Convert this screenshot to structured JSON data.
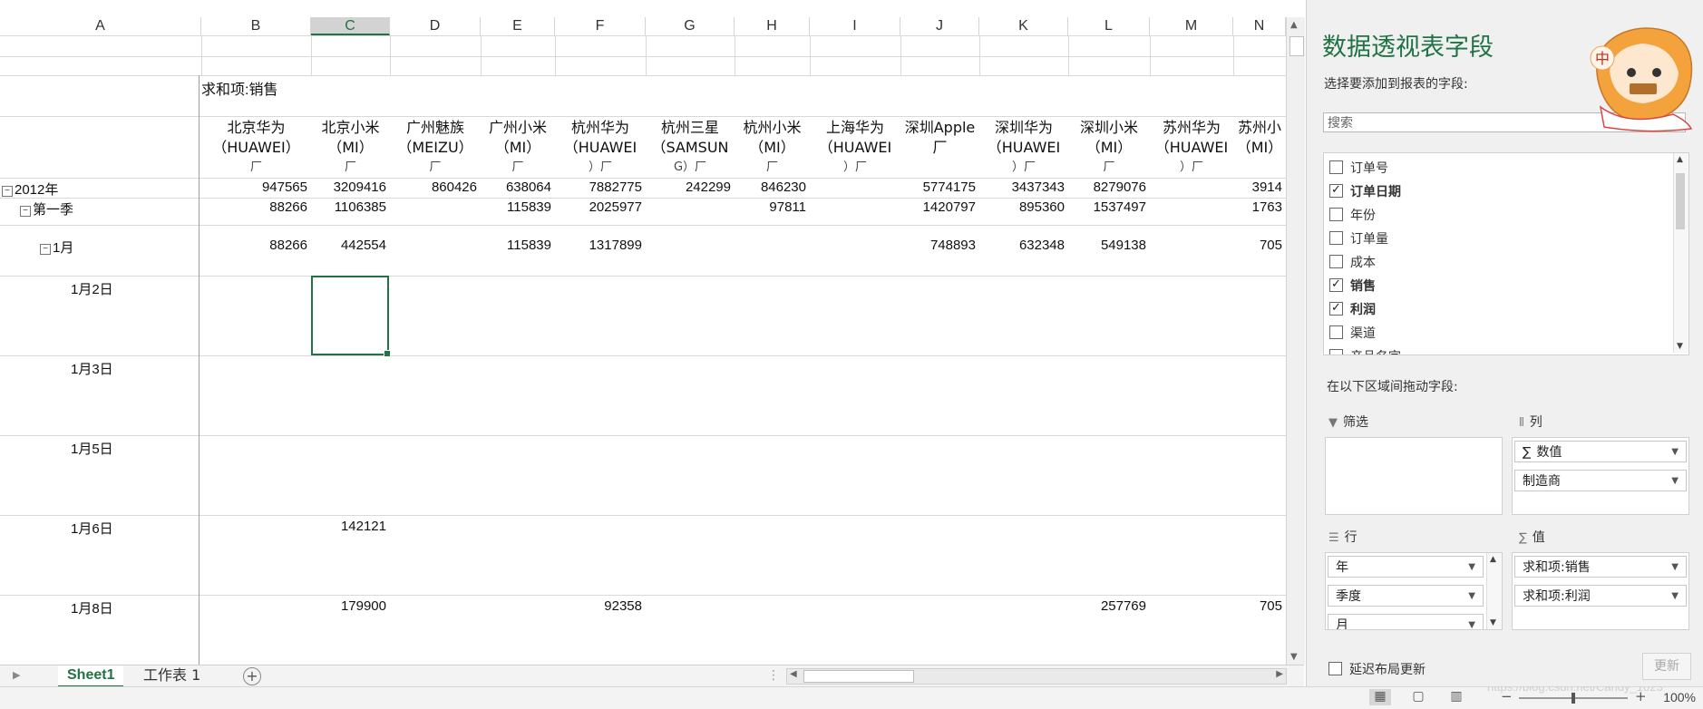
{
  "columns": [
    "A",
    "B",
    "C",
    "D",
    "E",
    "F",
    "G",
    "H",
    "I",
    "J",
    "K",
    "L",
    "M",
    "N"
  ],
  "selected_column": "C",
  "pivot": {
    "corner_label": "求和项:销售",
    "column_headers": [
      {
        "line1": "北京华为",
        "line2": "（HUAWEI）",
        "line3": "厂"
      },
      {
        "line1": "北京小米",
        "line2": "（MI）",
        "line3": "厂"
      },
      {
        "line1": "广州魅族",
        "line2": "（MEIZU）",
        "line3": "厂"
      },
      {
        "line1": "广州小米",
        "line2": "（MI）",
        "line3": "厂"
      },
      {
        "line1": "杭州华为",
        "line2": "（HUAWEI",
        "line3": "）厂"
      },
      {
        "line1": "杭州三星",
        "line2": "（SAMSUN",
        "line3": "G）厂"
      },
      {
        "line1": "杭州小米",
        "line2": "（MI）",
        "line3": "厂"
      },
      {
        "line1": "上海华为",
        "line2": "（HUAWEI",
        "line3": "）厂"
      },
      {
        "line1": "深圳Apple",
        "line2": "厂",
        "line3": ""
      },
      {
        "line1": "深圳华为",
        "line2": "（HUAWEI",
        "line3": "）厂"
      },
      {
        "line1": "深圳小米",
        "line2": "（MI）",
        "line3": "厂"
      },
      {
        "line1": "苏州华为",
        "line2": "（HUAWEI",
        "line3": "）厂"
      },
      {
        "line1": "苏州小",
        "line2": "（MI）",
        "line3": ""
      }
    ],
    "rows": [
      {
        "label": "2012年",
        "collapse": "⊟",
        "values": [
          "947565",
          "3209416",
          "860426",
          "638064",
          "7882775",
          "242299",
          "846230",
          "",
          "5774175",
          "3437343",
          "8279076",
          "",
          "3914"
        ]
      },
      {
        "label": "第一季",
        "collapse": "⊟",
        "values": [
          "88266",
          "1106385",
          "",
          "115839",
          "2025977",
          "",
          "97811",
          "",
          "1420797",
          "895360",
          "1537497",
          "",
          "1763"
        ]
      },
      {
        "label": "1月",
        "collapse": "⊟",
        "values": [
          "88266",
          "442554",
          "",
          "115839",
          "1317899",
          "",
          "",
          "",
          "748893",
          "632348",
          "549138",
          "",
          "705"
        ]
      },
      {
        "label": "1月2日",
        "collapse": "",
        "values": [
          "",
          "",
          "",
          "",
          "",
          "",
          "",
          "",
          "",
          "",
          "",
          "",
          ""
        ]
      },
      {
        "label": "1月3日",
        "collapse": "",
        "values": [
          "",
          "",
          "",
          "",
          "",
          "",
          "",
          "",
          "",
          "",
          "",
          "",
          ""
        ]
      },
      {
        "label": "1月5日",
        "collapse": "",
        "values": [
          "",
          "",
          "",
          "",
          "",
          "",
          "",
          "",
          "",
          "",
          "",
          "",
          ""
        ]
      },
      {
        "label": "1月6日",
        "collapse": "",
        "values": [
          "",
          "142121",
          "",
          "",
          "",
          "",
          "",
          "",
          "",
          "",
          "",
          "",
          ""
        ]
      },
      {
        "label": "1月8日",
        "collapse": "",
        "values": [
          "",
          "179900",
          "",
          "",
          "92358",
          "",
          "",
          "",
          "",
          "",
          "257769",
          "",
          "705"
        ]
      }
    ]
  },
  "sheets": {
    "active": "Sheet1",
    "other": "工作表 1",
    "add": "+"
  },
  "status": {
    "zoom": "100%",
    "watermark": "https://blog.csdn.net/Candy_1023"
  },
  "panel": {
    "title": "数据透视表字段",
    "subtitle": "选择要添加到报表的字段:",
    "search_placeholder": "搜索",
    "fields": [
      {
        "label": "订单号",
        "checked": false
      },
      {
        "label": "订单日期",
        "checked": true
      },
      {
        "label": "年份",
        "checked": false
      },
      {
        "label": "订单量",
        "checked": false
      },
      {
        "label": "成本",
        "checked": false
      },
      {
        "label": "销售",
        "checked": true
      },
      {
        "label": "利润",
        "checked": true
      },
      {
        "label": "渠道",
        "checked": false
      },
      {
        "label": "产品名字",
        "checked": false
      }
    ],
    "drag_title": "在以下区域间拖动字段:",
    "filter_label": "筛选",
    "columns_label": "列",
    "rows_label": "行",
    "values_label": "值",
    "columns_items": [
      "数值",
      "制造商"
    ],
    "columns_values_prefix": "∑",
    "rows_items": [
      "年",
      "季度",
      "月"
    ],
    "values_items": [
      "求和项:销售",
      "求和项:利润"
    ],
    "defer_label": "延迟布局更新",
    "update_label": "更新"
  }
}
